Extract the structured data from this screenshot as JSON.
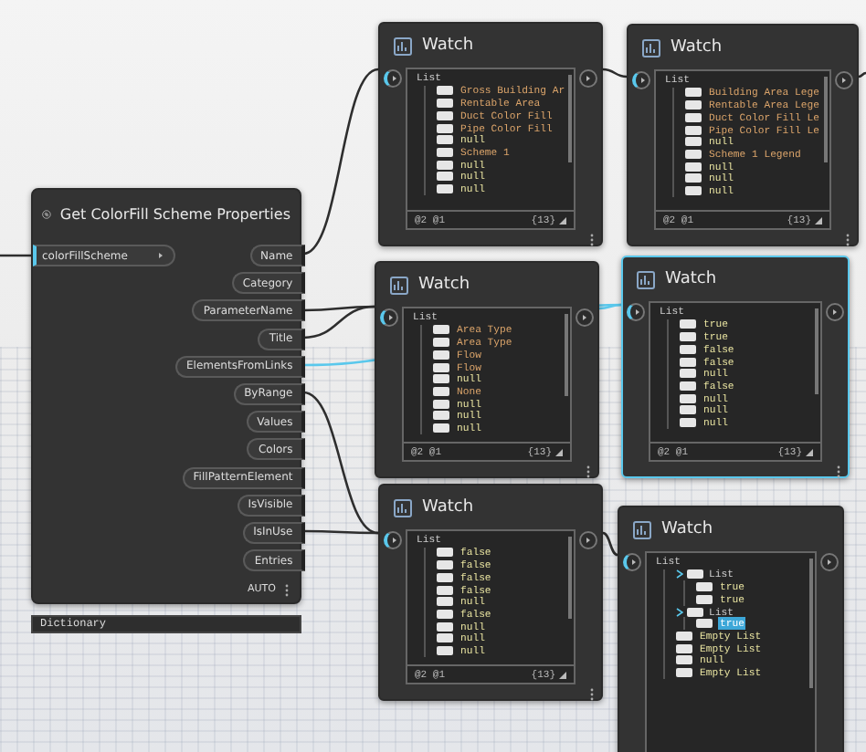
{
  "main_node": {
    "title": "Get ColorFill Scheme Properties",
    "input": "colorFillScheme",
    "outputs": [
      "Name",
      "Category",
      "ParameterName",
      "Title",
      "ElementsFromLinks",
      "ByRange",
      "Values",
      "Colors",
      "FillPatternElement",
      "IsVisible",
      "IsInUse",
      "Entries"
    ],
    "run_mode": "AUTO"
  },
  "output_preview": "Dictionary",
  "watch_nodes": [
    {
      "title": "Watch",
      "selected": false,
      "header": "List",
      "footer": "@2 @1",
      "count": "{13}",
      "items": [
        {
          "text": "Gross Building Ar",
          "kind": "string"
        },
        {
          "text": "Rentable Area",
          "kind": "string"
        },
        {
          "text": "Duct Color Fill",
          "kind": "string"
        },
        {
          "text": "Pipe Color Fill",
          "kind": "string"
        },
        {
          "text": "null",
          "kind": "value"
        },
        {
          "text": "Scheme 1",
          "kind": "string"
        },
        {
          "text": "null",
          "kind": "value"
        },
        {
          "text": "null",
          "kind": "value"
        },
        {
          "text": "null",
          "kind": "value"
        }
      ]
    },
    {
      "title": "Watch",
      "selected": false,
      "header": "List",
      "footer": "@2 @1",
      "count": "{13}",
      "items": [
        {
          "text": "Building Area Lege",
          "kind": "string"
        },
        {
          "text": "Rentable Area Lege",
          "kind": "string"
        },
        {
          "text": "Duct Color Fill Le",
          "kind": "string"
        },
        {
          "text": "Pipe Color Fill Le",
          "kind": "string"
        },
        {
          "text": "null",
          "kind": "value"
        },
        {
          "text": "Scheme 1 Legend",
          "kind": "string"
        },
        {
          "text": "null",
          "kind": "value"
        },
        {
          "text": "null",
          "kind": "value"
        },
        {
          "text": "null",
          "kind": "value"
        }
      ]
    },
    {
      "title": "Watch",
      "selected": false,
      "header": "List",
      "footer": "@2 @1",
      "count": "{13}",
      "items": [
        {
          "text": "Area Type",
          "kind": "string"
        },
        {
          "text": "Area Type",
          "kind": "string"
        },
        {
          "text": "Flow",
          "kind": "string"
        },
        {
          "text": "Flow",
          "kind": "string"
        },
        {
          "text": "null",
          "kind": "value"
        },
        {
          "text": "None",
          "kind": "string"
        },
        {
          "text": "null",
          "kind": "value"
        },
        {
          "text": "null",
          "kind": "value"
        },
        {
          "text": "null",
          "kind": "value"
        }
      ]
    },
    {
      "title": "Watch",
      "selected": true,
      "header": "List",
      "footer": "@2 @1",
      "count": "{13}",
      "items": [
        {
          "text": "true",
          "kind": "value"
        },
        {
          "text": "true",
          "kind": "value"
        },
        {
          "text": "false",
          "kind": "value"
        },
        {
          "text": "false",
          "kind": "value"
        },
        {
          "text": "null",
          "kind": "value"
        },
        {
          "text": "false",
          "kind": "value"
        },
        {
          "text": "null",
          "kind": "value"
        },
        {
          "text": "null",
          "kind": "value"
        },
        {
          "text": "null",
          "kind": "value"
        }
      ]
    },
    {
      "title": "Watch",
      "selected": false,
      "header": "List",
      "footer": "@2 @1",
      "count": "{13}",
      "items": [
        {
          "text": "false",
          "kind": "value"
        },
        {
          "text": "false",
          "kind": "value"
        },
        {
          "text": "false",
          "kind": "value"
        },
        {
          "text": "false",
          "kind": "value"
        },
        {
          "text": "null",
          "kind": "value"
        },
        {
          "text": "false",
          "kind": "value"
        },
        {
          "text": "null",
          "kind": "value"
        },
        {
          "text": "null",
          "kind": "value"
        },
        {
          "text": "null",
          "kind": "value"
        }
      ]
    },
    {
      "title": "Watch",
      "selected": false,
      "header": "List",
      "items": [
        {
          "text": "List",
          "kind": "list",
          "selected": false,
          "expanded": true,
          "children": [
            {
              "text": "true",
              "kind": "value",
              "selected": false
            },
            {
              "text": "true",
              "kind": "value",
              "selected": false
            }
          ]
        },
        {
          "text": "List",
          "kind": "list",
          "selected": false,
          "expanded": true,
          "children": [
            {
              "text": "true",
              "kind": "value",
              "selected": true
            }
          ]
        },
        {
          "text": "Empty List",
          "kind": "value",
          "selected": false
        },
        {
          "text": "Empty List",
          "kind": "value",
          "selected": false
        },
        {
          "text": "null",
          "kind": "value",
          "selected": false
        },
        {
          "text": "Empty List",
          "kind": "value",
          "selected": false
        }
      ]
    }
  ]
}
